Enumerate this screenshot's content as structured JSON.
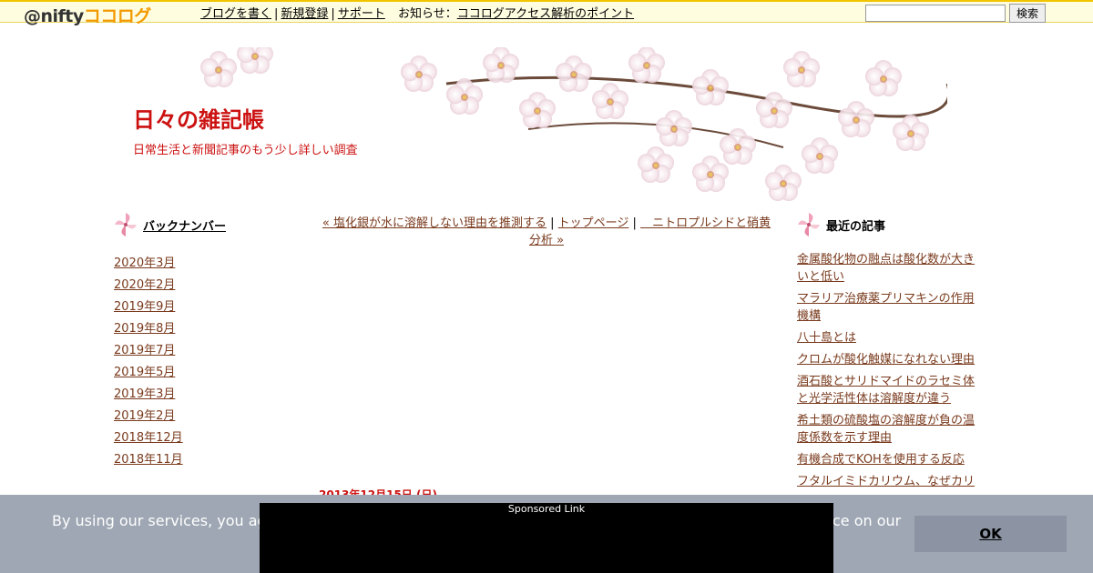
{
  "header": {
    "logo_at": "@nifty",
    "logo_cocolog": "ココログ",
    "nav_write": "ブログを書く",
    "nav_register": "新規登録",
    "nav_support": "サポート",
    "nav_notice_label": "お知らせ",
    "nav_notice_link": "ココログアクセス解析のポイント",
    "search_placeholder": "",
    "search_button": "検索"
  },
  "blog": {
    "title": "日々の雑記帳",
    "description": "日常生活と新聞記事のもう少し詳しい調査"
  },
  "left_sidebar": {
    "heading": "バックナンバー",
    "items": [
      "2020年3月",
      "2020年2月",
      "2019年9月",
      "2019年8月",
      "2019年7月",
      "2019年5月",
      "2019年3月",
      "2019年2月",
      "2018年12月",
      "2018年11月"
    ]
  },
  "right_sidebar": {
    "heading": "最近の記事",
    "items": [
      "金属酸化物の融点は酸化数が大きいと低い",
      "マラリア治療薬プリマキンの作用機構",
      "八十島とは",
      "クロムが酸化触媒になれない理由",
      "酒石酸とサリドマイドのラセミ体と光学活性体は溶解度が違う",
      "希土類の硫酸塩の溶解度が負の温度係数を示す理由",
      "有機合成でKOHを使用する反応",
      "フタルイミドカリウム、なぜカリ"
    ]
  },
  "post_nav": {
    "prev": "« 塩化銀が水に溶解しない理由を推測する",
    "sep1": " | ",
    "top": "トップページ",
    "sep2": " | ",
    "next": "　ニトロプルシドと硝黄分析 »"
  },
  "post": {
    "date": "2013年12月15日 (日)"
  },
  "cookie": {
    "text_start": "By using our services, you agree",
    "text_end": "ce on our",
    "ok_label": "OK"
  },
  "ad": {
    "label": "Sponsored Link"
  },
  "colors": {
    "title_red": "#cc1111",
    "link_brown": "#7a3b1e",
    "cookie_bg": "#9ea7b3",
    "logo_orange": "#f29a00"
  }
}
